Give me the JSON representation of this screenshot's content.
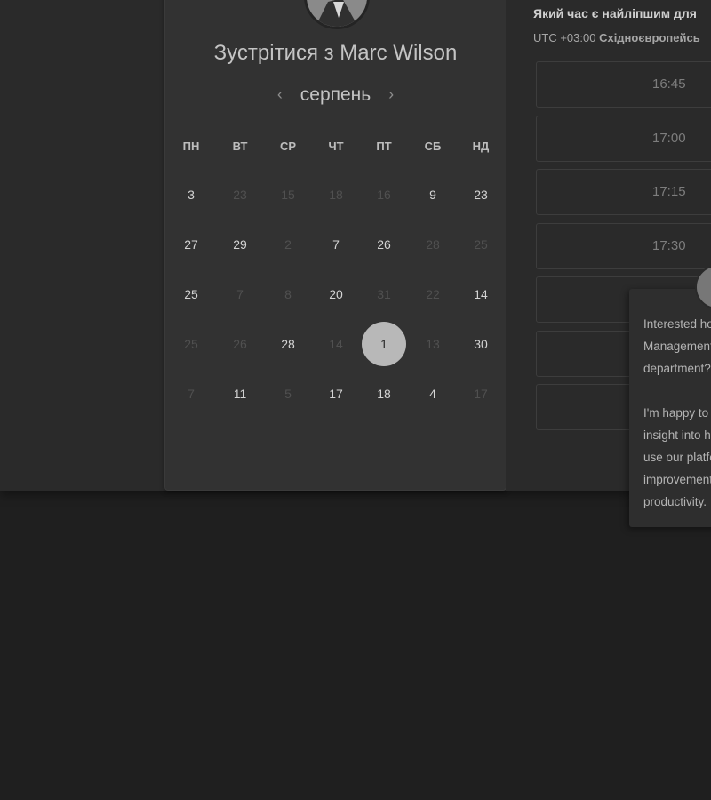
{
  "meeting": {
    "title": "Зустрітися з Marc Wilson",
    "month": "серпень",
    "prev_arrow": "‹",
    "next_arrow": "›"
  },
  "weekdays": [
    "ПН",
    "ВТ",
    "СР",
    "ЧТ",
    "ПТ",
    "СБ",
    "НД"
  ],
  "days": [
    [
      "3",
      "23",
      "15",
      "18",
      "16",
      "9",
      "23"
    ],
    [
      "27",
      "29",
      "2",
      "7",
      "26",
      "28",
      "25"
    ],
    [
      "25",
      "7",
      "8",
      "20",
      "31",
      "22",
      "14"
    ],
    [
      "25",
      "26",
      "28",
      "14",
      "1",
      "13",
      "30"
    ],
    [
      "7",
      "11",
      "5",
      "17",
      "18",
      "4",
      "17"
    ]
  ],
  "day_state": [
    [
      "a",
      "m",
      "m",
      "m",
      "m",
      "a",
      "a"
    ],
    [
      "a",
      "a",
      "m",
      "a",
      "a",
      "m",
      "m"
    ],
    [
      "a",
      "m",
      "m",
      "a",
      "m",
      "m",
      "a"
    ],
    [
      "m",
      "m",
      "a",
      "m",
      "s",
      "m",
      "a"
    ],
    [
      "m",
      "a",
      "m",
      "a",
      "a",
      "a",
      "m"
    ]
  ],
  "time_panel": {
    "question": "Який час є найліпшим для",
    "tz_offset": "UTC +03:00",
    "tz_name": "Східноєвропейсь"
  },
  "slots": [
    "16:45",
    "17:00",
    "17:15",
    "17:30",
    "",
    "",
    ""
  ],
  "chat": {
    "text": "Interested how\nManagement\ndepartment?\n\nI'm happy to s\ninsight into ho\nuse our platfo\nimprovement\nproductivity."
  }
}
